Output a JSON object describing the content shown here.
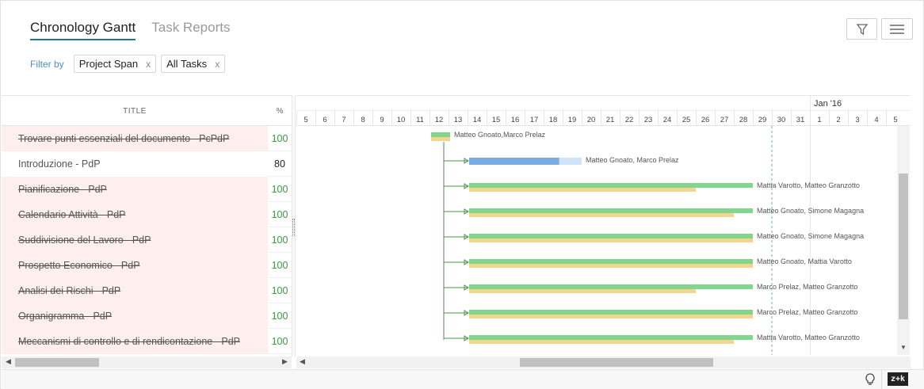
{
  "tabs": [
    {
      "label": "Chronology Gantt",
      "active": true
    },
    {
      "label": "Task Reports",
      "active": false
    }
  ],
  "filter": {
    "label": "Filter by",
    "chips": [
      {
        "label": "Project Span",
        "remove": "x"
      },
      {
        "label": "All Tasks",
        "remove": "x"
      }
    ]
  },
  "grid": {
    "header": {
      "title": "TITLE",
      "percent": "%"
    },
    "rows": [
      {
        "title": "Trovare punti essenziali del documento - PcPdP",
        "percent": "100",
        "done": true
      },
      {
        "title": "Introduzione - PdP",
        "percent": "80",
        "done": false
      },
      {
        "title": "Pianificazione - PdP",
        "percent": "100",
        "done": true
      },
      {
        "title": "Calendario Attività - PdP",
        "percent": "100",
        "done": true
      },
      {
        "title": "Suddivisione del Lavoro - PdP",
        "percent": "100",
        "done": true
      },
      {
        "title": "Prospetto Economico - PdP",
        "percent": "100",
        "done": true
      },
      {
        "title": "Analisi dei Rischi - PdP",
        "percent": "100",
        "done": true
      },
      {
        "title": "Organigramma - PdP",
        "percent": "100",
        "done": true
      },
      {
        "title": "Meccanismi di controllo e di rendicontazione - PdP",
        "percent": "100",
        "done": true
      }
    ]
  },
  "timeline": {
    "month_label": "Jan '16",
    "days": [
      "5",
      "6",
      "7",
      "8",
      "9",
      "10",
      "11",
      "12",
      "13",
      "14",
      "15",
      "16",
      "17",
      "18",
      "19",
      "20",
      "21",
      "22",
      "23",
      "24",
      "25",
      "26",
      "27",
      "28",
      "29",
      "30",
      "31",
      "1",
      "2",
      "3",
      "4",
      "5"
    ],
    "today_day_index": 24.5,
    "tasks": [
      {
        "assignees": "Matteo Gnoato,Marco Prelaz",
        "start": 7,
        "end": 8,
        "progress": 1.0,
        "baseline_end": 8
      },
      {
        "assignees": "Matteo Gnoato, Marco Prelaz",
        "start": 9,
        "end": 15,
        "progress": 0.8,
        "baseline_end": null
      },
      {
        "assignees": "Mattia Varotto, Matteo Granzotto",
        "start": 9,
        "end": 24,
        "progress": 1.0,
        "baseline_end": 21
      },
      {
        "assignees": "Matteo Gnoato, Simone Magagna",
        "start": 9,
        "end": 24,
        "progress": 1.0,
        "baseline_end": 23
      },
      {
        "assignees": "Matteo Gnoato, Simone Magagna",
        "start": 9,
        "end": 24,
        "progress": 1.0,
        "baseline_end": 24
      },
      {
        "assignees": "Matteo Gnoato, Mattia Varotto",
        "start": 9,
        "end": 24,
        "progress": 1.0,
        "baseline_end": 24
      },
      {
        "assignees": "Marco Prelaz, Matteo Granzotto",
        "start": 9,
        "end": 24,
        "progress": 1.0,
        "baseline_end": 21
      },
      {
        "assignees": "Marco Prelaz, Matteo Granzotto",
        "start": 9,
        "end": 24,
        "progress": 1.0,
        "baseline_end": 24
      },
      {
        "assignees": "Mattia Varotto, Matteo Granzotto",
        "start": 9,
        "end": 24,
        "progress": 1.0,
        "baseline_end": 23
      }
    ]
  },
  "colors": {
    "done_bar": "#7fd68c",
    "progress_bar": "#7aaae0",
    "remaining_bar": "#cfe4fa",
    "baseline_bar": "#f5d58e",
    "connector": "#4f8f4f",
    "today_line": "#6dbb6d"
  },
  "icons": {
    "filter": "filter-icon",
    "menu": "menu-icon",
    "bulb": "lightbulb-icon"
  },
  "footer": {
    "shortcut_label": "z+k"
  }
}
